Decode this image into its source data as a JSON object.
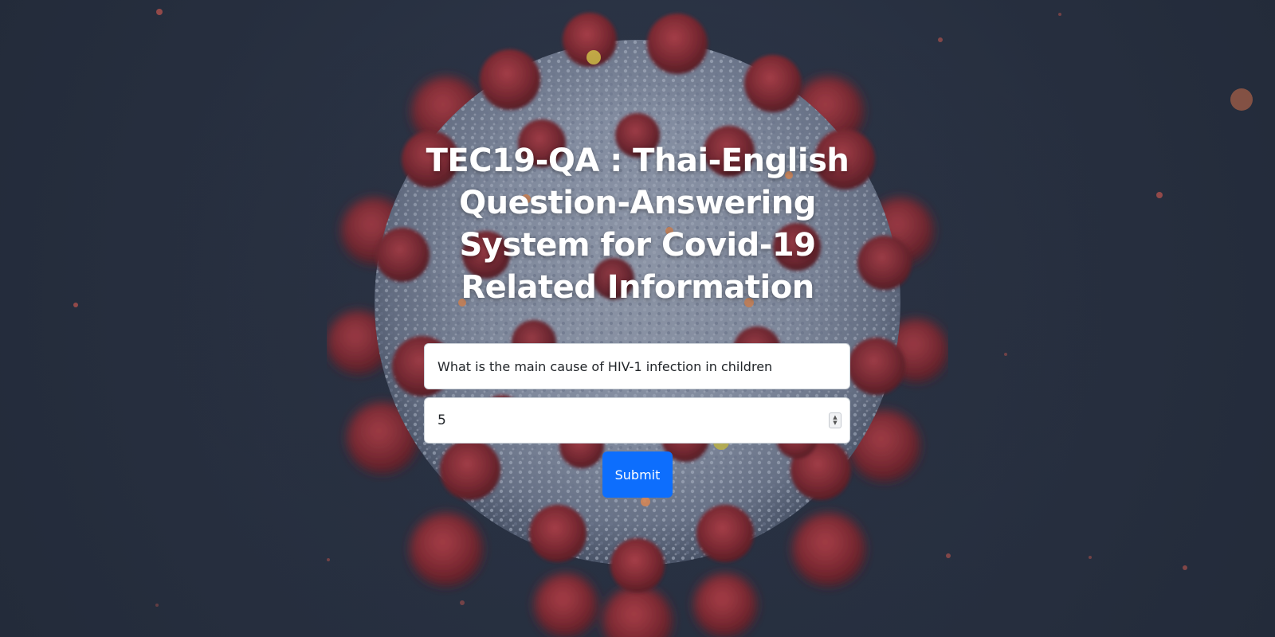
{
  "page": {
    "title": "TEC19-QA : Thai-English Question-Answering System for Covid-19 Related Information"
  },
  "form": {
    "question_value": "What is the main cause of HIV-1 infection in children",
    "count_value": "5",
    "submit_label": "Submit"
  },
  "colors": {
    "background": "#2b3445",
    "button": "#0d6efd",
    "spike": "#8a2f38",
    "virus_body": "#8d97ab"
  },
  "icons": {
    "spinner": "number-spinner-icon",
    "background_image": "coronavirus-illustration"
  }
}
